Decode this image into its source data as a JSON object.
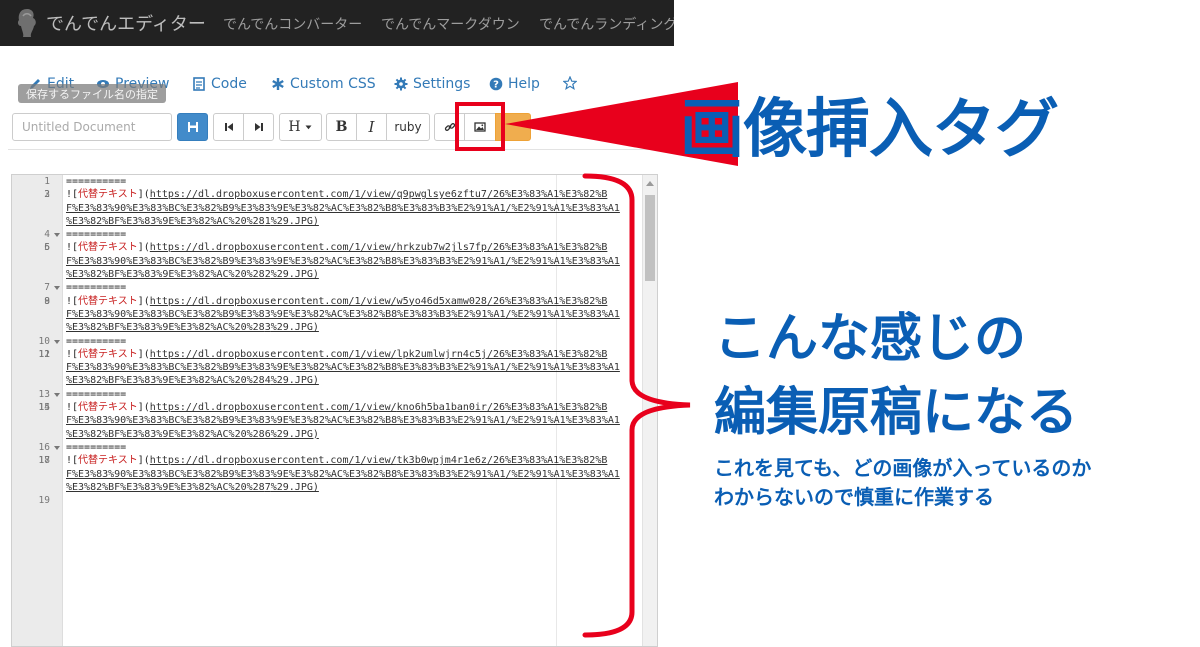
{
  "app": {
    "brand": "でんでんエディター",
    "nav_links": [
      "でんでんコンバーター",
      "でんでんマークダウン",
      "でんでんランディングペ"
    ]
  },
  "menu": {
    "edit": "Edit",
    "preview": "Preview",
    "code": "Code",
    "custom_css": "Custom CSS",
    "settings": "Settings",
    "help": "Help"
  },
  "tooltip": "保存するファイル名の指定",
  "toolbar": {
    "filename_placeholder": "Untitled Document",
    "heading_label": "H",
    "bold_label": "B",
    "italic_label": "I",
    "ruby_label": "ruby"
  },
  "editor": {
    "alt_text": "代替テキスト",
    "separator": "==========",
    "url_prefix": "https://dl.dropboxusercontent.com/1/view/",
    "url_part2": "F%E3%83%90%E3%83%BC%E3%82%B9%E3%83%9E%E3%82%AC%E3%82%B8%E3%83%B3%E2%91%A1/%E2%91%A1%E3%83%A1",
    "url_part3_prefix": "%E3%82%BF%E3%83%9E%E3%82%AC%20%28",
    "url_part3_suffix": "%29.JPG)",
    "url_tail1": "/26%E3%83%A1%E3%82%B",
    "blocks": [
      {
        "id": "q9pwglsye6zftu7",
        "num": "1"
      },
      {
        "id": "hrkzub7w2jls7fp",
        "num": "2"
      },
      {
        "id": "w5yo46d5xamw028",
        "num": "3"
      },
      {
        "id": "lpk2umlwjrn4c5j",
        "num": "4"
      },
      {
        "id": "kno6h5ba1ban0ir",
        "num": "6"
      },
      {
        "id": "tk3b0wpjm4r1e6z",
        "num": "7"
      }
    ]
  },
  "annotations": {
    "title": "画像挿入タグ",
    "body_line1": "こんな感じの",
    "body_line2": "編集原稿になる",
    "note_line1": "これを見ても、どの画像が入っているのか",
    "note_line2": "わからないので慎重に作業する"
  },
  "colors": {
    "navbar_bg": "#222222",
    "link_blue": "#337ab7",
    "primary_btn": "#428bca",
    "callout_red": "#e8001c",
    "annotation_blue": "#0a5eb4",
    "alt_text_red": "#c82020"
  }
}
